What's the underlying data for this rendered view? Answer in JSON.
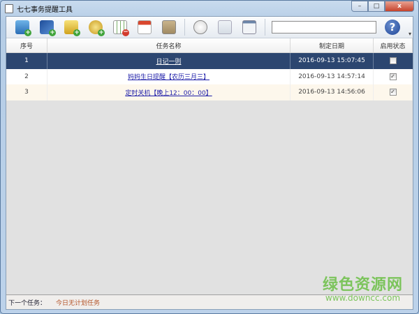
{
  "window": {
    "title": "七七事务提醒工具",
    "minimize": "–",
    "maximize": "□",
    "close": "x"
  },
  "toolbar": {
    "search_value": "",
    "help": "?",
    "overflow": "▾"
  },
  "table": {
    "columns": [
      "序号",
      "任务名称",
      "制定日期",
      "启用状态"
    ],
    "rows": [
      {
        "index": "1",
        "name": "日记一则",
        "date": "2016-09-13 15:07:45",
        "enabled": false,
        "mark": ""
      },
      {
        "index": "2",
        "name": "妈妈生日提醒【农历三月三】",
        "date": "2016-09-13 14:57:14",
        "enabled": true,
        "mark": "✓"
      },
      {
        "index": "3",
        "name": "定时关机【晚上12：00：00】",
        "date": "2016-09-13 14:56:06",
        "enabled": true,
        "mark": "✓"
      }
    ]
  },
  "status": {
    "label": "下一个任务：",
    "value": "今日无计划任务"
  },
  "watermark": {
    "title": "绿色资源网",
    "url": "www.downcc.com"
  }
}
